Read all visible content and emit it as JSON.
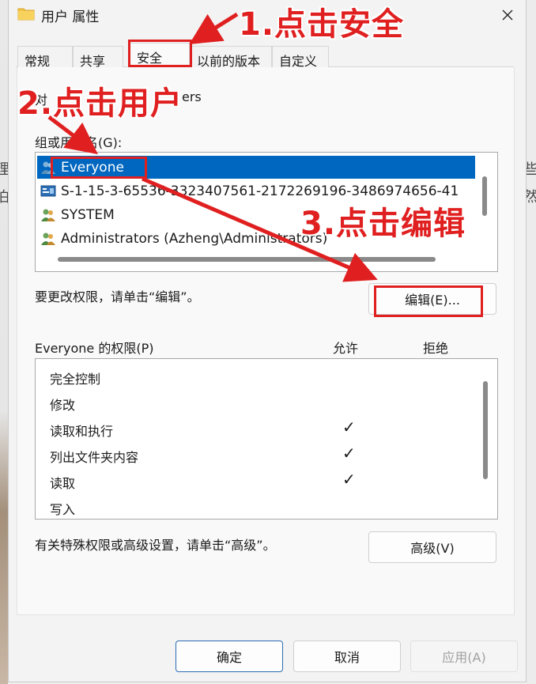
{
  "background": {
    "stray_chars": [
      "理",
      "泊",
      "些",
      "然"
    ]
  },
  "window": {
    "title": "用户 属性",
    "close_icon": "close-icon"
  },
  "tabs": [
    {
      "label": "常规"
    },
    {
      "label": "共享"
    },
    {
      "label": "安全",
      "active": true
    },
    {
      "label": "以前的版本"
    },
    {
      "label": "自定义"
    }
  ],
  "security": {
    "object_name_partial": "对      ers",
    "object_name_left": "对",
    "object_name_right": "ers",
    "groups_label": "组或用户名(G):",
    "users": [
      {
        "name": "Everyone",
        "icon": "group-icon",
        "selected": true
      },
      {
        "name": "S-1-15-3-65536-3323407561-2172269196-3486974656-41",
        "icon": "sid-icon"
      },
      {
        "name": "SYSTEM",
        "icon": "group-icon"
      },
      {
        "name": "Administrators (Azheng\\Administrators)",
        "icon": "group-icon"
      }
    ],
    "change_hint": "要更改权限，请单击“编辑”。",
    "edit_button": "编辑(E)...",
    "perm_header": "Everyone 的权限(P)",
    "allow_header": "允许",
    "deny_header": "拒绝",
    "permissions": [
      {
        "name": "完全控制",
        "allow": ""
      },
      {
        "name": "修改",
        "allow": ""
      },
      {
        "name": "读取和执行",
        "allow": "✓"
      },
      {
        "name": "列出文件夹内容",
        "allow": "✓"
      },
      {
        "name": "读取",
        "allow": "✓"
      },
      {
        "name": "写入",
        "allow": ""
      }
    ],
    "advanced_hint": "有关特殊权限或高级设置，请单击“高级”。",
    "advanced_button": "高级(V)"
  },
  "footer": {
    "ok": "确定",
    "cancel": "取消",
    "apply": "应用(A)"
  },
  "annotations": {
    "step1": "1.点击安全",
    "step2": "2.点击用户",
    "step3": "3.点击编辑",
    "color": "#e02020"
  }
}
